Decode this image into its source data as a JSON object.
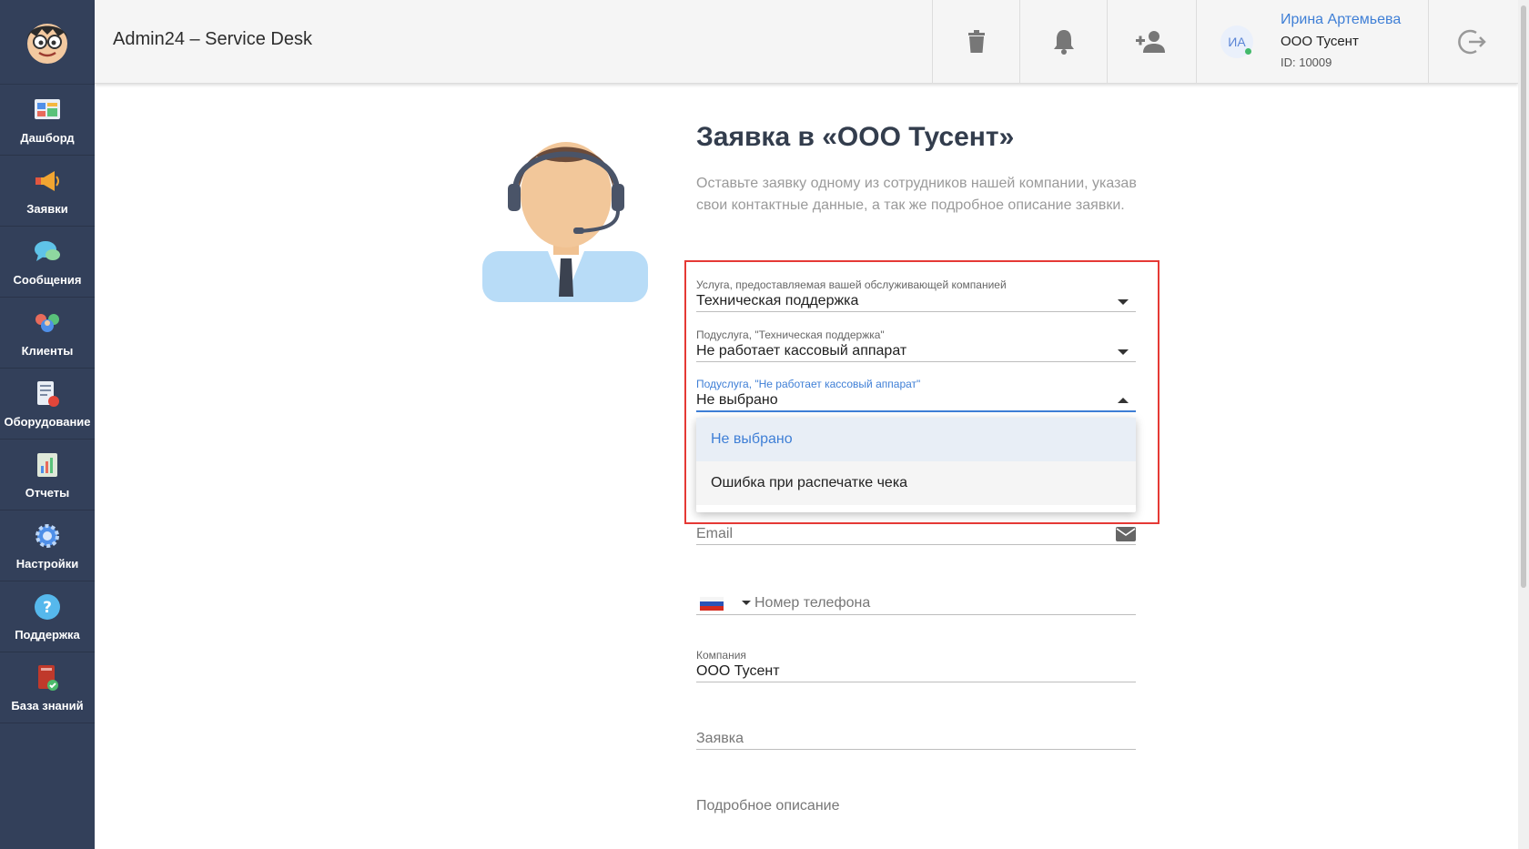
{
  "app": {
    "title": "Admin24 – Service Desk"
  },
  "sidebar": {
    "items": [
      {
        "label": "Дашборд",
        "icon": "dashboard-icon"
      },
      {
        "label": "Заявки",
        "icon": "megaphone-icon"
      },
      {
        "label": "Сообщения",
        "icon": "chat-icon"
      },
      {
        "label": "Клиенты",
        "icon": "clients-icon"
      },
      {
        "label": "Оборудование",
        "icon": "equipment-icon"
      },
      {
        "label": "Отчеты",
        "icon": "reports-icon"
      },
      {
        "label": "Настройки",
        "icon": "gear-icon"
      },
      {
        "label": "Поддержка",
        "icon": "help-icon"
      },
      {
        "label": "База знаний",
        "icon": "knowledge-base-icon"
      }
    ]
  },
  "header": {
    "user": {
      "initials": "ИА",
      "name": "Ирина Артемьева",
      "company": "ООО Тусент",
      "id": "ID: 10009"
    }
  },
  "main": {
    "title": "Заявка в «ООО Тусент»",
    "description": "Оставьте заявку одному из сотрудников нашей компании, указав свои контактные данные, а так же подробное описание заявки.",
    "fields": {
      "service": {
        "label": "Услуга, предоставляемая вашей обслуживающей компанией",
        "value": "Техническая поддержка"
      },
      "subservice1": {
        "label": "Подуслуга, \"Техническая поддержка\"",
        "value": "Не работает кассовый аппарат"
      },
      "subservice2": {
        "label": "Подуслуга, \"Не работает кассовый аппарат\"",
        "value": "Не выбрано"
      },
      "email": {
        "placeholder": "Email"
      },
      "phone": {
        "placeholder": "Номер телефона"
      },
      "company": {
        "label": "Компания",
        "value": "ООО Тусент"
      },
      "request": {
        "placeholder": "Заявка"
      },
      "details": {
        "placeholder": "Подробное описание"
      }
    },
    "dropdown": {
      "options": [
        "Не выбрано",
        "Ошибка при распечатке чека"
      ],
      "selected": "Не выбрано"
    }
  },
  "colors": {
    "sidebar": "#33405a",
    "accent": "#3f7fd6",
    "highlight": "#e53935"
  }
}
